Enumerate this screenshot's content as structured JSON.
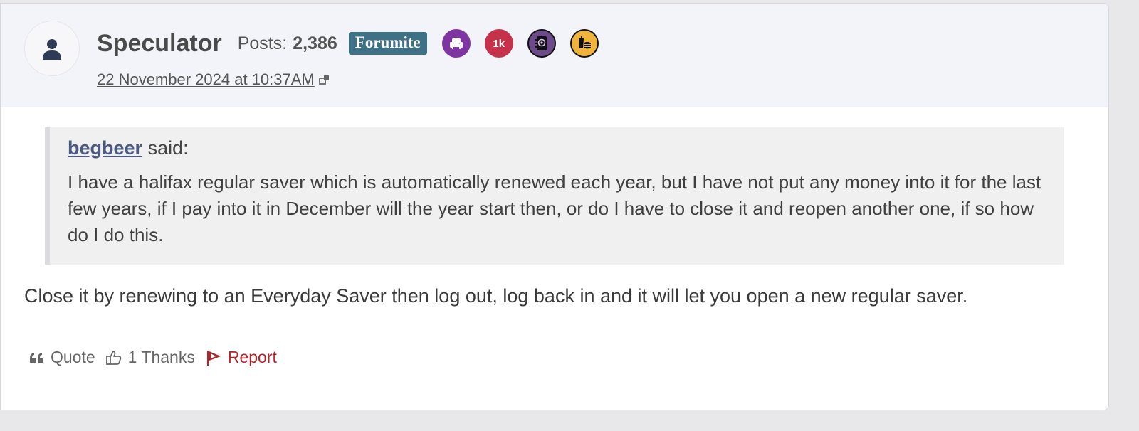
{
  "post": {
    "author": {
      "name": "Speculator",
      "posts_label": "Posts:",
      "posts_count": "2,386",
      "role_badge": "Forumite",
      "badges": [
        {
          "icon": "armchair-icon",
          "color": "#7e35a2"
        },
        {
          "label": "1k",
          "color": "#c63249"
        },
        {
          "icon": "address-book-icon",
          "color": "#6d4a8a"
        },
        {
          "icon": "food-drink-icon",
          "color": "#f0b43a"
        }
      ]
    },
    "timestamp": "22 November 2024 at 10:37AM",
    "quote": {
      "author": "begbeer",
      "said_label": "said:",
      "text": "I have a halifax regular saver which is automatically renewed each year, but I have not put any money into it for the last few years, if I pay into it in December will the year start then,  or do I have to close it and reopen another one, if so how do I do this."
    },
    "body": "Close it by renewing to an Everyday Saver then log out, log back in and it will let you open a new regular saver.",
    "actions": {
      "quote": "Quote",
      "thanks": "1 Thanks",
      "report": "Report"
    }
  }
}
